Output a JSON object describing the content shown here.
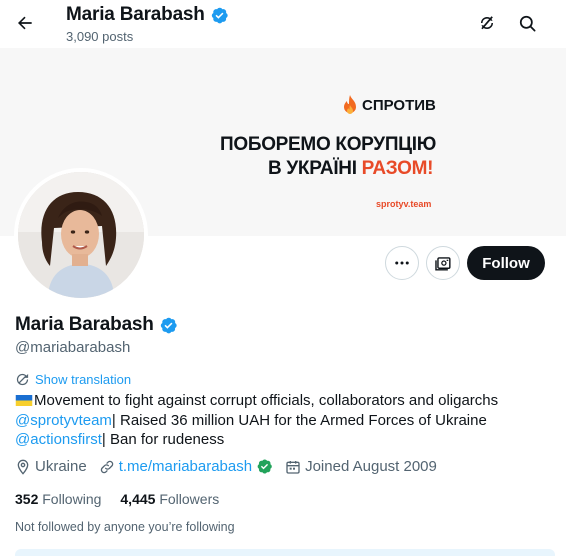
{
  "header": {
    "name": "Maria Barabash",
    "posts_count": "3,090 posts",
    "back_icon": "arrow-left-icon",
    "refresh_icon": "refresh-icon",
    "search_icon": "search-icon"
  },
  "banner": {
    "brand": "СПРОТИВ",
    "line1": "ПОБОРЕМО КОРУПЦІЮ",
    "line2_start": "В УКРАЇНІ ",
    "line2_accent": "РАЗОМ!",
    "site": "sprotyv.team",
    "accent_color": "#e84a28"
  },
  "actions": {
    "more_icon": "more-icon",
    "subscribe_icon": "newsletter-icon",
    "follow_label": "Follow"
  },
  "profile": {
    "name": "Maria Barabash",
    "handle": "@mariabarabash",
    "verified_color": "#1d9bf0",
    "show_translation": "Show translation",
    "bio": {
      "line1_text": "Movement to fight against corrupt officials, collaborators and oligarchs",
      "line2_link": "@sprotyvteam",
      "line2_text": "| Raised 36 million UAH for the Armed Forces of Ukraine",
      "line3_link": "@actionsfirst",
      "line3_text": "| Ban for rudeness"
    },
    "location": "Ukraine",
    "website": "t.me/mariabarabash",
    "joined": "Joined August 2009",
    "following_count": "352",
    "following_label": "Following",
    "followers_count": "4,445",
    "followers_label": "Followers",
    "followed_by": "Not followed by anyone you’re following"
  }
}
